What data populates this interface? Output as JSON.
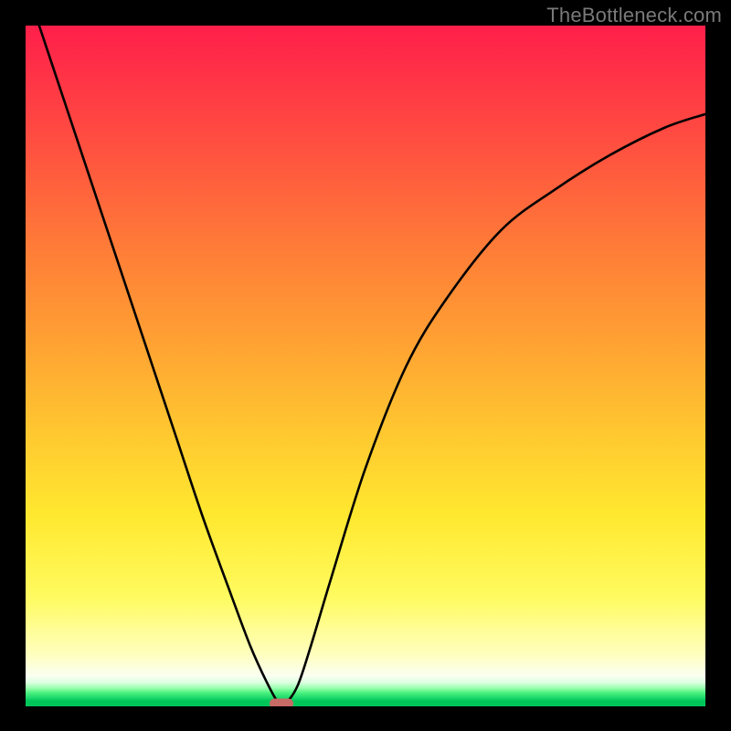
{
  "watermark": "TheBottleneck.com",
  "chart_data": {
    "type": "line",
    "title": "",
    "xlabel": "",
    "ylabel": "",
    "xlim": [
      0,
      100
    ],
    "ylim": [
      0,
      100
    ],
    "colors": {
      "gradient_top": "#ff1f4a",
      "gradient_mid": "#ffe82f",
      "gradient_bottom": "#00c659",
      "curve": "#000000",
      "marker": "#c86b66",
      "frame": "#000000"
    },
    "series": [
      {
        "name": "bottleneck-curve",
        "points": [
          {
            "x": 2,
            "y": 100
          },
          {
            "x": 6,
            "y": 88
          },
          {
            "x": 10,
            "y": 76
          },
          {
            "x": 14,
            "y": 64
          },
          {
            "x": 18,
            "y": 52
          },
          {
            "x": 22,
            "y": 40
          },
          {
            "x": 26,
            "y": 28
          },
          {
            "x": 30,
            "y": 17
          },
          {
            "x": 33,
            "y": 9
          },
          {
            "x": 35.5,
            "y": 3.5
          },
          {
            "x": 37.2,
            "y": 0.5
          },
          {
            "x": 38.2,
            "y": 0.4
          },
          {
            "x": 40,
            "y": 3
          },
          {
            "x": 42,
            "y": 9
          },
          {
            "x": 45,
            "y": 19
          },
          {
            "x": 50,
            "y": 35
          },
          {
            "x": 56,
            "y": 50
          },
          {
            "x": 62,
            "y": 60
          },
          {
            "x": 70,
            "y": 70
          },
          {
            "x": 78,
            "y": 76
          },
          {
            "x": 86,
            "y": 81
          },
          {
            "x": 94,
            "y": 85
          },
          {
            "x": 100,
            "y": 87
          }
        ]
      }
    ],
    "marker": {
      "x": 37.6,
      "y": 0.4
    }
  }
}
